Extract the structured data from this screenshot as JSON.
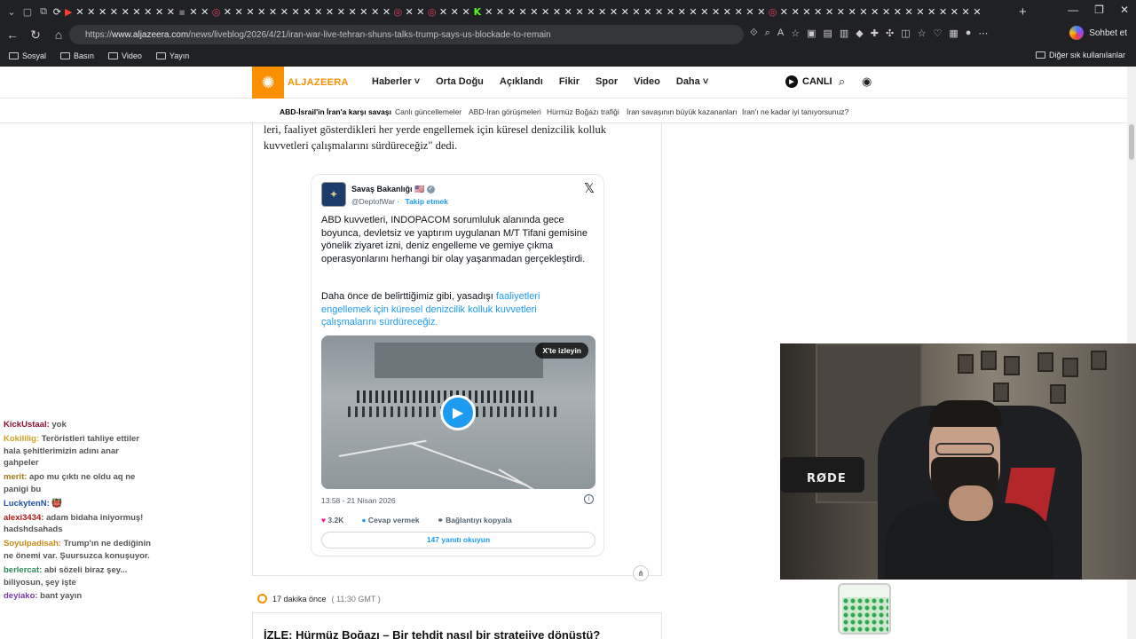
{
  "browser": {
    "tabs_count_hint": "",
    "url_prefix": "https://",
    "url_host": "www.aljazeera.com",
    "url_path": "/news/liveblog/2026/4/21/iran-war-live-tehran-shuns-talks-trump-says-us-blockade-to-remain",
    "chat_button": "Sohbet et",
    "bookmarks": [
      "Sosyal",
      "Basın",
      "Video",
      "Yayın"
    ],
    "other_bookmarks": "Diğer sık kullanılanlar"
  },
  "site": {
    "logo_text": "ALJAZEERA",
    "nav": [
      "Haberler",
      "Orta Doğu",
      "Açıklandı",
      "Fikir",
      "Spor",
      "Video",
      "Daha"
    ],
    "live_label": "CANLI",
    "sub_nav": [
      "ABD-İsrail'in İran'a karşı savaşı",
      "Canlı güncellemeler",
      "ABD-İran görüşmeleri",
      "Hürmüz Boğazı trafiği",
      "İran savaşının büyük kazananları",
      "İran'ı ne kadar iyi tanıyorsunuz?"
    ]
  },
  "article": {
    "text_line1": "leri, faaliyet gösterdikleri her yerde engellemek için küresel denizcilik kolluk",
    "text_line2": "kuvvetleri çalışmalarını sürdüreceğiz\" dedi.",
    "tweet": {
      "author": "Savaş Bakanlığı",
      "flag": "🇺🇸",
      "handle": "@DeptofWar",
      "follow": "Takip etmek",
      "body": "ABD kuvvetleri, INDOPACOM sorumluluk alanında gece boyunca, devletsiz ve yaptırım uygulanan M/T Tifani gemisine yönelik ziyaret izni, deniz engelleme ve gemiye çıkma operasyonlarını herhangi bir olay yaşanmadan gerçekleştirdi.",
      "body2_plain": "Daha önce de belirttiğimiz gibi, yasadışı",
      "body2_link": "faaliyetleri engellemek için küresel denizcilik kolluk kuvvetleri çalışmalarını sürdüreceğiz.",
      "watch_on_x": "X'te izleyin",
      "timestamp": "13:58 - 21 Nisan 2026",
      "likes": "3.2K",
      "reply": "Cevap vermek",
      "copy_link": "Bağlantıyı kopyala",
      "read_replies": "147 yanıtı okuyun"
    },
    "timeline_time": "17 dakika önce",
    "timeline_gmt": "( 11:30 GMT )",
    "next_title": "İZLE: Hürmüz Boğazı – Bir tehdit nasıl bir stratejiye dönüştü?"
  },
  "chat": [
    {
      "user": "KickUstaal:",
      "color": "#8b0f2e",
      "msg": "yok"
    },
    {
      "user": "Kokililig:",
      "color": "#c9a227",
      "msg": "Teröristleri tahliye ettiler hala şehitlerimizin adını anar gahpeler"
    },
    {
      "user": "merit:",
      "color": "#a07a1a",
      "msg": "apo mu çıktı ne oldu aq ne panigi bu"
    },
    {
      "user": "LuckytenN:",
      "color": "#1f4fa8",
      "msg": "👹"
    },
    {
      "user": "alexi3434:",
      "color": "#b01818",
      "msg": "adam bidaha iniyormuş! hadshdsahads"
    },
    {
      "user": "Soyulpadisah:",
      "color": "#c78a1a",
      "msg": "Trump'ın ne dediğinin ne önemi var. Şuursuzca konuşuyor."
    },
    {
      "user": "berlercat:",
      "color": "#2a8a5a",
      "msg": "abi sözeli biraz şey... biliyosun, şey işte"
    },
    {
      "user": "deyiako:",
      "color": "#7a3aa8",
      "msg": "bant yayın"
    }
  ],
  "webcam": {
    "mic_brand": "RØDE"
  }
}
